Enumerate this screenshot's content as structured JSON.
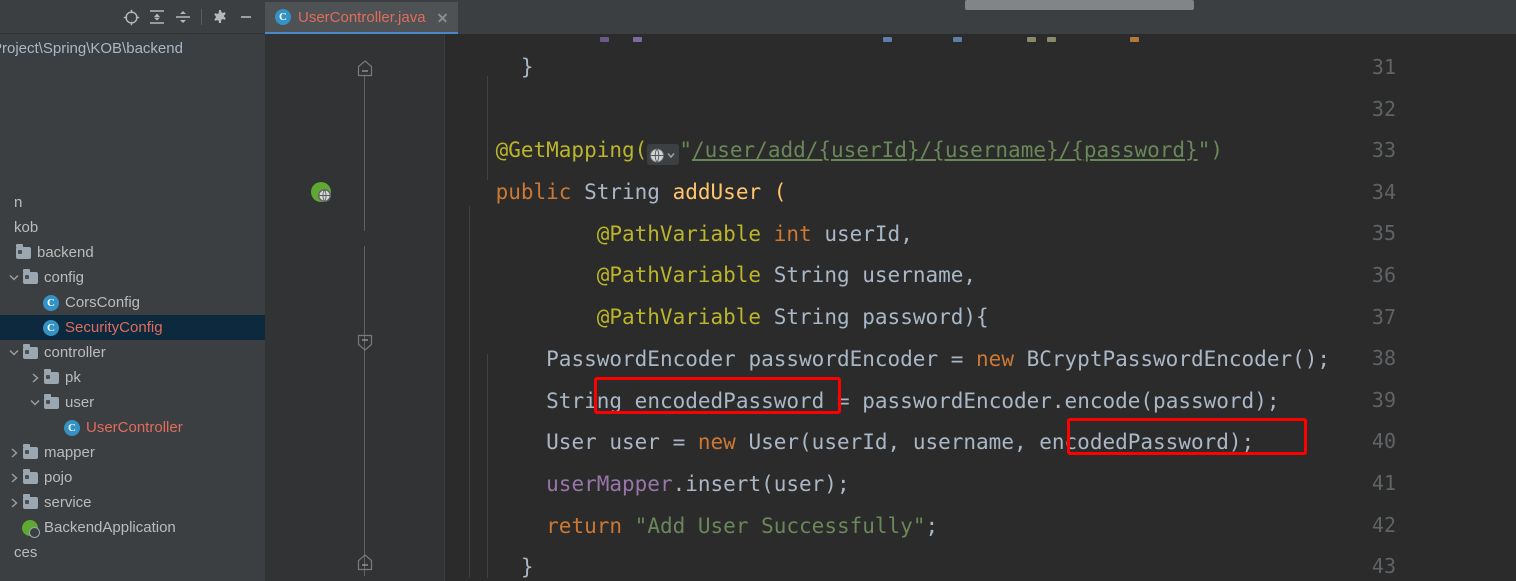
{
  "app": {
    "theme": "Darcula",
    "editor_bg": "#2b2b2b",
    "gutter_bg": "#313335",
    "panel_bg": "#3c3f41",
    "selection_bg": "#0d293e",
    "annotation_color": "#ff0000",
    "accent": "#4a88c7"
  },
  "sidebar": {
    "toolbar": [
      {
        "name": "select-opened-file-icon",
        "label": "Select Opened File"
      },
      {
        "name": "expand-all-icon",
        "label": "Expand All"
      },
      {
        "name": "collapse-all-icon",
        "label": "Collapse All"
      },
      {
        "name": "settings-gear-icon",
        "label": "Settings"
      },
      {
        "name": "hide-icon",
        "label": "Hide"
      }
    ],
    "path": "Project\\Spring\\KOB\\backend",
    "tree": [
      {
        "label": "n",
        "indent": 0,
        "arrow": "none",
        "icon": "none",
        "clipped": true,
        "selected": false,
        "color": "default"
      },
      {
        "label": "kob",
        "indent": 0,
        "arrow": "none",
        "icon": "none",
        "clipped": true,
        "selected": false,
        "color": "default"
      },
      {
        "label": "backend",
        "indent": 0,
        "arrow": "none",
        "icon": "folder",
        "clipped": false,
        "selected": false,
        "color": "default"
      },
      {
        "label": "config",
        "indent": 1,
        "arrow": "down",
        "icon": "folder",
        "clipped": false,
        "selected": false,
        "color": "default"
      },
      {
        "label": "CorsConfig",
        "indent": 2,
        "arrow": "none",
        "icon": "class",
        "clipped": false,
        "selected": false,
        "color": "default"
      },
      {
        "label": "SecurityConfig",
        "indent": 2,
        "arrow": "none",
        "icon": "class",
        "clipped": false,
        "selected": true,
        "color": "salmon"
      },
      {
        "label": "controller",
        "indent": 1,
        "arrow": "down",
        "icon": "folder",
        "clipped": false,
        "selected": false,
        "color": "default"
      },
      {
        "label": "pk",
        "indent": 2,
        "arrow": "right",
        "icon": "folder",
        "clipped": false,
        "selected": false,
        "color": "default"
      },
      {
        "label": "user",
        "indent": 2,
        "arrow": "down",
        "icon": "folder",
        "clipped": false,
        "selected": false,
        "color": "default"
      },
      {
        "label": "UserController",
        "indent": 3,
        "arrow": "none",
        "icon": "class",
        "clipped": false,
        "selected": false,
        "color": "salmon"
      },
      {
        "label": "mapper",
        "indent": 1,
        "arrow": "right",
        "icon": "folder",
        "clipped": false,
        "selected": false,
        "color": "default"
      },
      {
        "label": "pojo",
        "indent": 1,
        "arrow": "right",
        "icon": "folder",
        "clipped": false,
        "selected": false,
        "color": "default"
      },
      {
        "label": "service",
        "indent": 1,
        "arrow": "right",
        "icon": "folder",
        "clipped": false,
        "selected": false,
        "color": "default"
      },
      {
        "label": "BackendApplication",
        "indent": 1,
        "arrow": "none",
        "icon": "spring",
        "clipped": false,
        "selected": false,
        "color": "default"
      },
      {
        "label": "ces",
        "indent": 0,
        "arrow": "none",
        "icon": "none",
        "clipped": true,
        "selected": false,
        "color": "default"
      }
    ]
  },
  "editor": {
    "tab": {
      "title": "UserController.java",
      "icon": "java-class-icon",
      "close_label": "Close"
    },
    "file_url": "/user/add/{userId}/{username}/{password}",
    "gutter_icons": [
      {
        "line": 34,
        "name": "spring-request-mapping-globe-icon"
      }
    ],
    "fold_markers": [
      {
        "line": 31,
        "type": "end"
      },
      {
        "line": 37,
        "type": "collapse"
      },
      {
        "line": 43,
        "type": "end"
      }
    ],
    "line_numbers": [
      31,
      32,
      33,
      34,
      35,
      36,
      37,
      38,
      39,
      40,
      41,
      42,
      43
    ],
    "lines": [
      {
        "n": 31,
        "text": "    }"
      },
      {
        "n": 32,
        "text": ""
      },
      {
        "n": 33,
        "text": "    @GetMapping(\"/user/add/{userId}/{username}/{password}\")"
      },
      {
        "n": 34,
        "text": "    public String addUser ("
      },
      {
        "n": 35,
        "text": "            @PathVariable int userId,"
      },
      {
        "n": 36,
        "text": "            @PathVariable String username,"
      },
      {
        "n": 37,
        "text": "            @PathVariable String password){"
      },
      {
        "n": 38,
        "text": "        PasswordEncoder passwordEncoder = new BCryptPasswordEncoder();"
      },
      {
        "n": 39,
        "text": "        String encodedPassword = passwordEncoder.encode(password);"
      },
      {
        "n": 40,
        "text": "        User user = new User(userId, username, encodedPassword);"
      },
      {
        "n": 41,
        "text": "        userMapper.insert(user);"
      },
      {
        "n": 42,
        "text": "        return \"Add User Successfully\";"
      },
      {
        "n": 43,
        "text": "    }"
      }
    ],
    "tokens": {
      "l31_brace": "}",
      "l33_ann": "@GetMapping",
      "l33_open": "(",
      "l33_quote": "\"",
      "l33_url": "/user/add/{userId}/{username}/{password}",
      "l33_close": "\")",
      "l34_kw": "public",
      "l34_type": "String",
      "l34_name": "addUser (",
      "l35_ann": "@PathVariable",
      "l35_kw": "int",
      "l35_name": "userId,",
      "l36_ann": "@PathVariable",
      "l36_type": "String",
      "l36_name": "username,",
      "l37_ann": "@PathVariable",
      "l37_type": "String",
      "l37_name": "password){",
      "l38_a": "PasswordEncoder passwordEncoder = ",
      "l38_kw": "new",
      "l38_b": " BCryptPasswordEncoder();",
      "l39_a": "String ",
      "l39_var": "encodedPassword",
      "l39_b": " = passwordEncoder.encode(password);",
      "l40_a": "User user = ",
      "l40_kw": "new",
      "l40_b": " User(userId, username, ",
      "l40_var": "encodedPassword",
      "l40_c": ");",
      "l41_field": "userMapper",
      "l41_rest": ".insert(user);",
      "l42_kw": "return",
      "l42_str": "\"Add User Successfully\"",
      "l42_semi": ";",
      "l43_brace": "}"
    },
    "annotations": [
      {
        "name": "highlight-encoded-password-declaration",
        "target": "encodedPassword",
        "line": 39
      },
      {
        "name": "highlight-encoded-password-usage",
        "target": "encodedPassword",
        "line": 40
      }
    ]
  }
}
